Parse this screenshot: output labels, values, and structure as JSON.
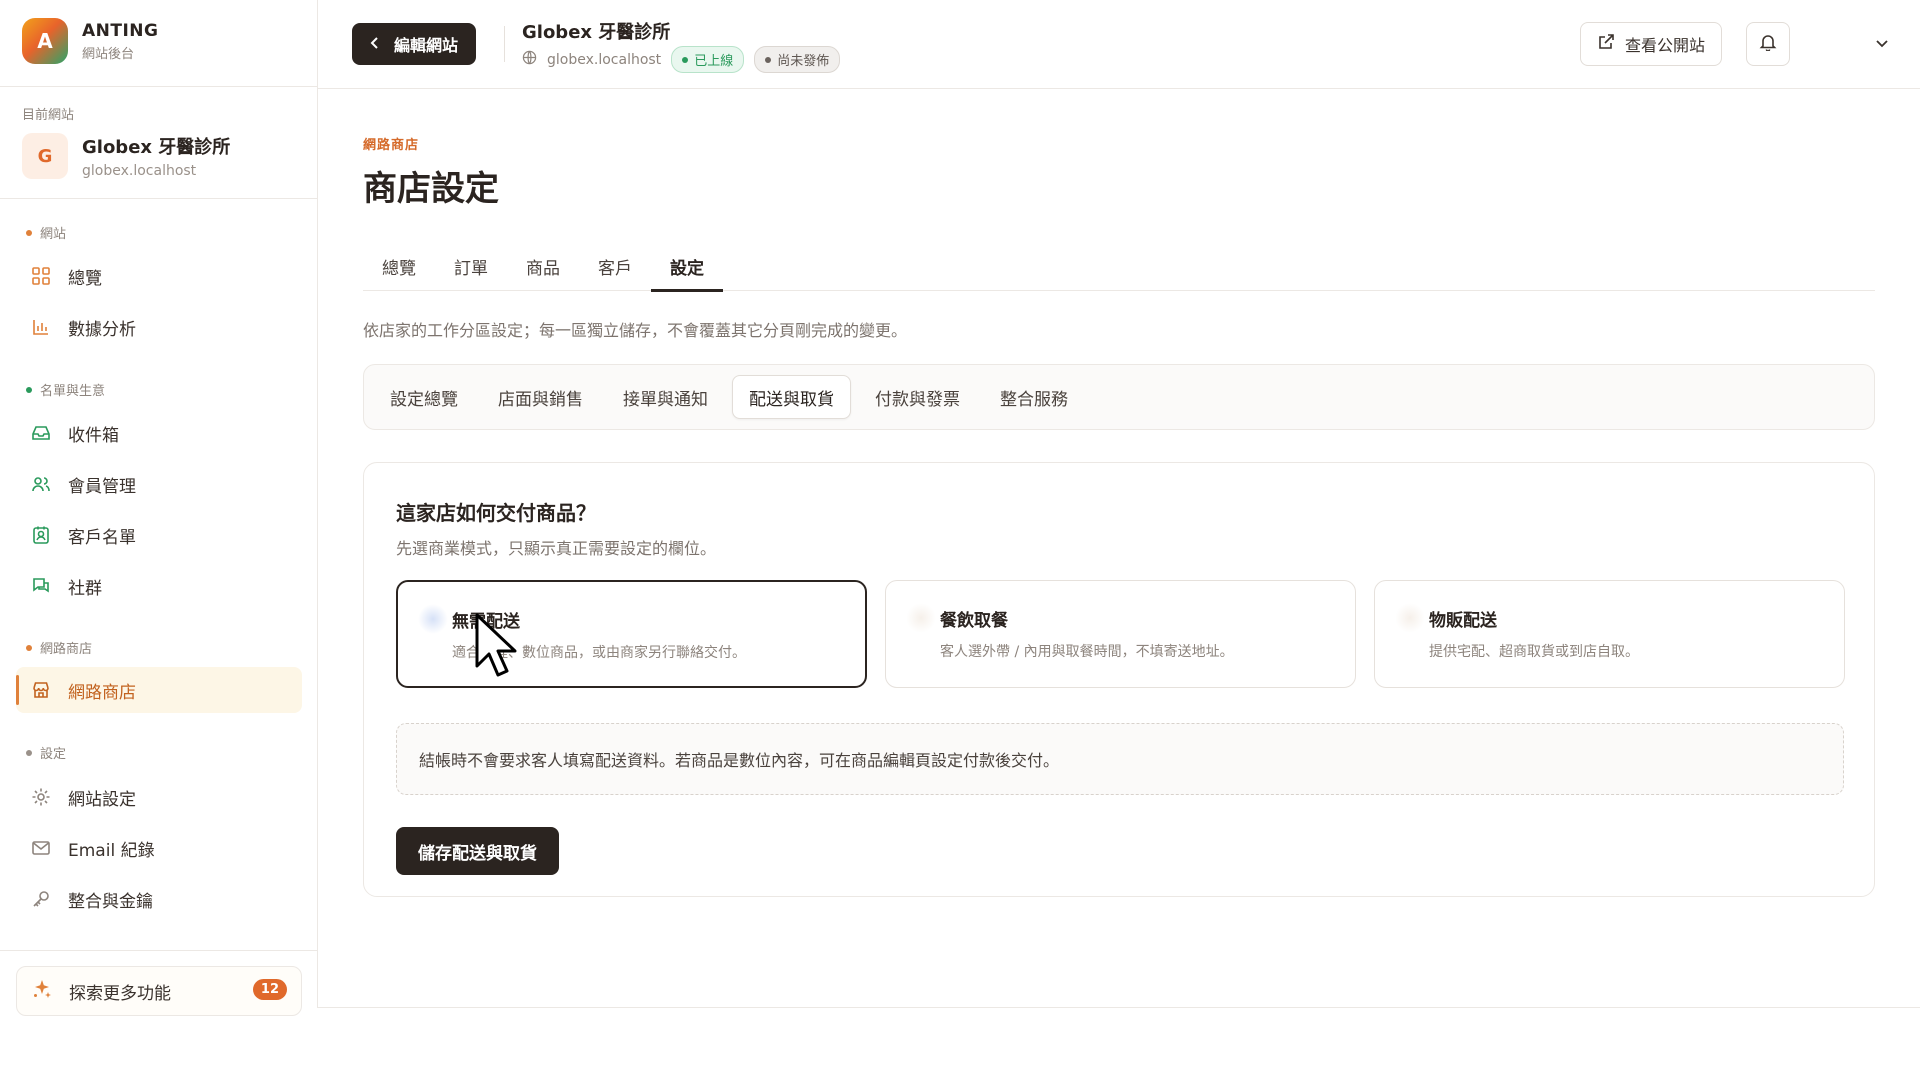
{
  "brand": {
    "logo_letter": "A",
    "name": "ANTING",
    "subtitle": "網站後台"
  },
  "current_site": {
    "label": "目前網站",
    "avatar": "G",
    "name": "Globex 牙醫診所",
    "domain": "globex.localhost"
  },
  "sidebar": {
    "sections": [
      {
        "label": "網站",
        "dot_color": "#e0813a"
      },
      {
        "label": "名單與生意",
        "dot_color": "#2a9a5c"
      },
      {
        "label": "網路商店",
        "dot_color": "#e0813a"
      },
      {
        "label": "設定",
        "dot_color": "#9a918a"
      }
    ],
    "items": [
      {
        "label": "總覽",
        "icon": "grid-icon"
      },
      {
        "label": "數據分析",
        "icon": "bar-chart-icon"
      },
      {
        "label": "收件箱",
        "icon": "inbox-icon"
      },
      {
        "label": "會員管理",
        "icon": "users-icon"
      },
      {
        "label": "客戶名單",
        "icon": "contact-icon"
      },
      {
        "label": "社群",
        "icon": "chat-icon"
      },
      {
        "label": "網路商店",
        "icon": "store-icon",
        "active": true
      },
      {
        "label": "網站設定",
        "icon": "gear-icon"
      },
      {
        "label": "Email 紀錄",
        "icon": "mail-icon"
      },
      {
        "label": "整合與金鑰",
        "icon": "key-icon"
      }
    ],
    "explore": {
      "label": "探索更多功能",
      "badge": "12",
      "icon": "sparkle-icon"
    }
  },
  "header": {
    "back_label": "編輯網站",
    "title": "Globex 牙醫診所",
    "domain": "globex.localhost",
    "status_live": "已上線",
    "status_unpublished": "尚未發佈",
    "view_public_label": "查看公開站"
  },
  "page": {
    "eyebrow": "網路商店",
    "title": "商店設定",
    "tabs": [
      "總覽",
      "訂單",
      "商品",
      "客戶",
      "設定"
    ],
    "active_tab": "設定",
    "description": "依店家的工作分區設定；每一區獨立儲存，不會覆蓋其它分頁剛完成的變更。",
    "subtabs": [
      "設定總覽",
      "店面與銷售",
      "接單與通知",
      "配送與取貨",
      "付款與發票",
      "整合服務"
    ],
    "active_subtab": "配送與取貨"
  },
  "delivery_card": {
    "title": "這家店如何交付商品？",
    "subtitle": "先選商業模式，只顯示真正需要設定的欄位。",
    "options": [
      {
        "title": "無需配送",
        "desc": "適合課程、數位商品，或由商家另行聯絡交付。",
        "selected": true
      },
      {
        "title": "餐飲取餐",
        "desc": "客人選外帶 / 內用與取餐時間，不填寄送地址。",
        "selected": false
      },
      {
        "title": "物販配送",
        "desc": "提供宅配、超商取貨或到店自取。",
        "selected": false
      }
    ],
    "note": "結帳時不會要求客人填寫配送資料。若商品是數位內容，可在商品編輯頁設定付款後交付。",
    "save_label": "儲存配送與取貨"
  },
  "colors": {
    "accent": "#e0692b",
    "dark": "#2b2420",
    "success": "#2a9a5c"
  }
}
